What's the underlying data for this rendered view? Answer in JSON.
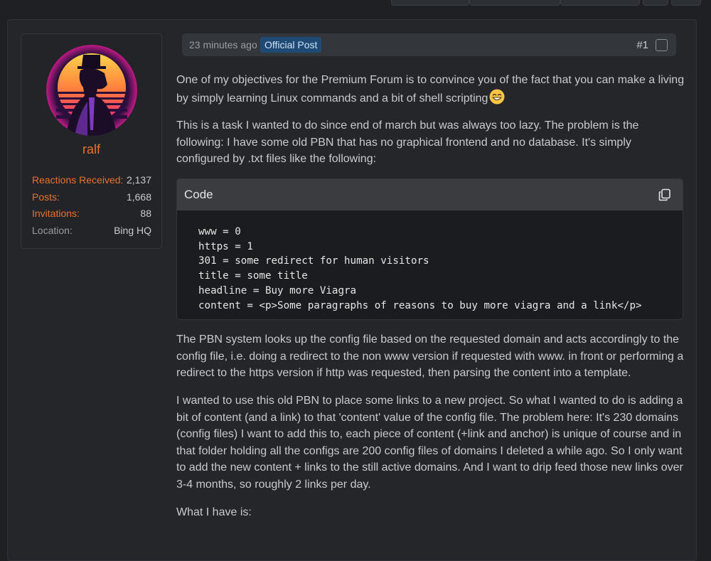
{
  "post": {
    "time": "23 minutes ago",
    "badge": "Official Post",
    "number": "#1"
  },
  "author": {
    "name": "ralf",
    "stats": [
      {
        "label": "Reactions Received:",
        "value": "2,137"
      },
      {
        "label": "Posts:",
        "value": "1,668"
      },
      {
        "label": "Invitations:",
        "value": "88"
      },
      {
        "label": "Location:",
        "value": "Bing HQ"
      }
    ]
  },
  "content": {
    "p1": "One of my objectives for the Premium Forum is to convince you of the fact that you can make a living by simply learning Linux commands and a bit of shell scripting",
    "p2": "This is a task I wanted to do since end of march but was always too lazy. The problem is the following: I have some old PBN that has no graphical frontend and no database. It's simply configured by .txt files like the following:",
    "code_title": "Code",
    "code_lines": [
      "www = 0",
      "https = 1",
      "301 = some redirect for human visitors",
      "title = some title",
      "headline = Buy more Viagra",
      "content = <p>Some paragraphs of reasons to buy more viagra and a link</p>"
    ],
    "p3": "The PBN system looks up the config file based on the requested domain and acts accordingly to the config file, i.e. doing a redirect to the non www version if requested with www. in front or performing a redirect to the https version if http was requested, then parsing the content into a template.",
    "p4": "I wanted to use this old PBN to place some links to a new project. So what I wanted to do is adding a bit of content (and a link) to that 'content' value of the config file. The problem here: It's 230 domains (config files) I want to add this to, each piece of content (+link and anchor) is unique of course and in that folder holding all the configs are 200 config files of domains I deleted a while ago. So I only want to add the new content + links to the still active domains. And I want to drip feed those new links over 3-4 months, so roughly 2 links per day.",
    "p5": "What I have is:"
  },
  "colors": {
    "accent": "#e8722e",
    "badge": "#1f4a76",
    "background": "#1e2024"
  },
  "icons": [
    "smiling-face-icon",
    "copy-icon",
    "checkbox"
  ]
}
